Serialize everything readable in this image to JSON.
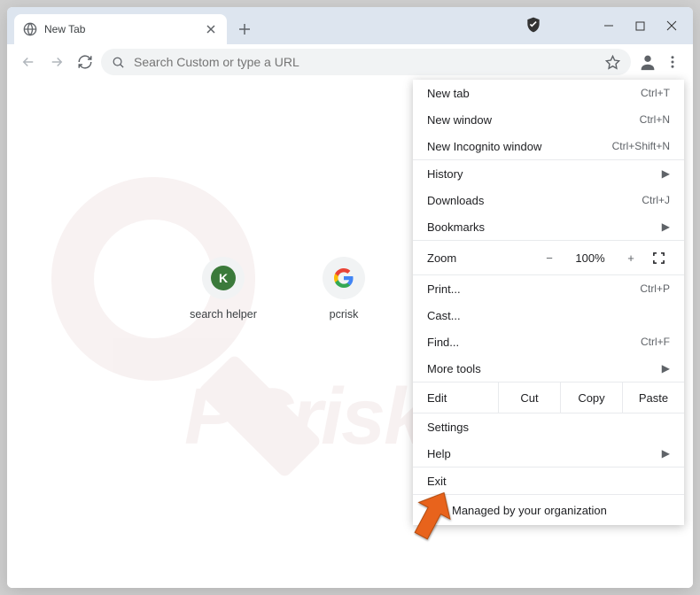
{
  "tab": {
    "title": "New Tab"
  },
  "omnibox": {
    "placeholder": "Search Custom or type a URL"
  },
  "shortcuts": [
    {
      "label": "search helper",
      "badge": "K"
    },
    {
      "label": "pcrisk",
      "badge": "G"
    }
  ],
  "menu": {
    "new_tab": {
      "label": "New tab",
      "accel": "Ctrl+T"
    },
    "new_window": {
      "label": "New window",
      "accel": "Ctrl+N"
    },
    "new_incognito": {
      "label": "New Incognito window",
      "accel": "Ctrl+Shift+N"
    },
    "history": {
      "label": "History"
    },
    "downloads": {
      "label": "Downloads",
      "accel": "Ctrl+J"
    },
    "bookmarks": {
      "label": "Bookmarks"
    },
    "zoom": {
      "label": "Zoom",
      "value": "100%",
      "minus": "−",
      "plus": "+"
    },
    "print": {
      "label": "Print...",
      "accel": "Ctrl+P"
    },
    "cast": {
      "label": "Cast..."
    },
    "find": {
      "label": "Find...",
      "accel": "Ctrl+F"
    },
    "more_tools": {
      "label": "More tools"
    },
    "edit": {
      "label": "Edit",
      "cut": "Cut",
      "copy": "Copy",
      "paste": "Paste"
    },
    "settings": {
      "label": "Settings"
    },
    "help": {
      "label": "Help"
    },
    "exit": {
      "label": "Exit"
    },
    "managed": {
      "label": "Managed by your organization"
    }
  },
  "watermark": "PCrisk.com"
}
